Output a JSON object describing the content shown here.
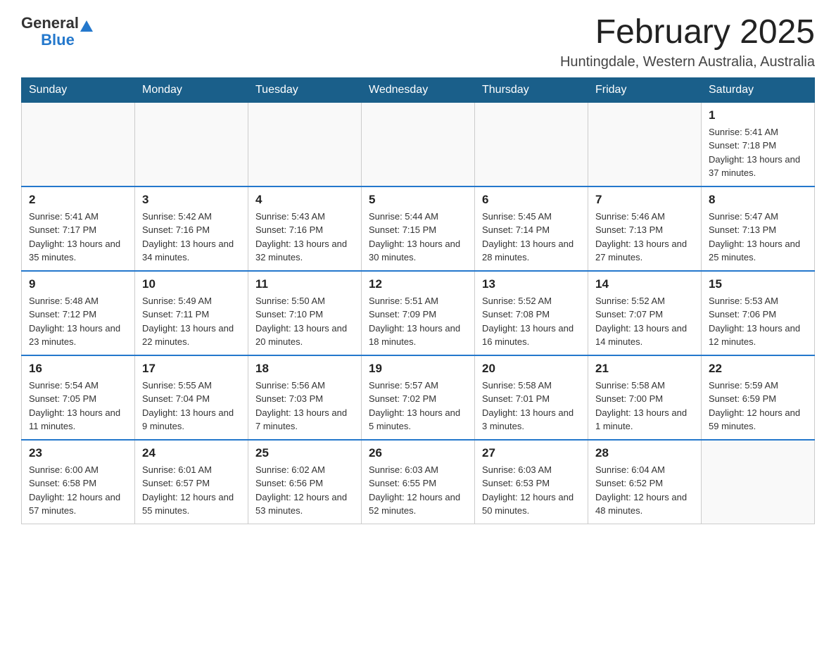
{
  "header": {
    "logo_general": "General",
    "logo_blue": "Blue",
    "month": "February 2025",
    "location": "Huntingdale, Western Australia, Australia"
  },
  "days_of_week": [
    "Sunday",
    "Monday",
    "Tuesday",
    "Wednesday",
    "Thursday",
    "Friday",
    "Saturday"
  ],
  "weeks": [
    [
      {
        "day": "",
        "info": ""
      },
      {
        "day": "",
        "info": ""
      },
      {
        "day": "",
        "info": ""
      },
      {
        "day": "",
        "info": ""
      },
      {
        "day": "",
        "info": ""
      },
      {
        "day": "",
        "info": ""
      },
      {
        "day": "1",
        "info": "Sunrise: 5:41 AM\nSunset: 7:18 PM\nDaylight: 13 hours and 37 minutes."
      }
    ],
    [
      {
        "day": "2",
        "info": "Sunrise: 5:41 AM\nSunset: 7:17 PM\nDaylight: 13 hours and 35 minutes."
      },
      {
        "day": "3",
        "info": "Sunrise: 5:42 AM\nSunset: 7:16 PM\nDaylight: 13 hours and 34 minutes."
      },
      {
        "day": "4",
        "info": "Sunrise: 5:43 AM\nSunset: 7:16 PM\nDaylight: 13 hours and 32 minutes."
      },
      {
        "day": "5",
        "info": "Sunrise: 5:44 AM\nSunset: 7:15 PM\nDaylight: 13 hours and 30 minutes."
      },
      {
        "day": "6",
        "info": "Sunrise: 5:45 AM\nSunset: 7:14 PM\nDaylight: 13 hours and 28 minutes."
      },
      {
        "day": "7",
        "info": "Sunrise: 5:46 AM\nSunset: 7:13 PM\nDaylight: 13 hours and 27 minutes."
      },
      {
        "day": "8",
        "info": "Sunrise: 5:47 AM\nSunset: 7:13 PM\nDaylight: 13 hours and 25 minutes."
      }
    ],
    [
      {
        "day": "9",
        "info": "Sunrise: 5:48 AM\nSunset: 7:12 PM\nDaylight: 13 hours and 23 minutes."
      },
      {
        "day": "10",
        "info": "Sunrise: 5:49 AM\nSunset: 7:11 PM\nDaylight: 13 hours and 22 minutes."
      },
      {
        "day": "11",
        "info": "Sunrise: 5:50 AM\nSunset: 7:10 PM\nDaylight: 13 hours and 20 minutes."
      },
      {
        "day": "12",
        "info": "Sunrise: 5:51 AM\nSunset: 7:09 PM\nDaylight: 13 hours and 18 minutes."
      },
      {
        "day": "13",
        "info": "Sunrise: 5:52 AM\nSunset: 7:08 PM\nDaylight: 13 hours and 16 minutes."
      },
      {
        "day": "14",
        "info": "Sunrise: 5:52 AM\nSunset: 7:07 PM\nDaylight: 13 hours and 14 minutes."
      },
      {
        "day": "15",
        "info": "Sunrise: 5:53 AM\nSunset: 7:06 PM\nDaylight: 13 hours and 12 minutes."
      }
    ],
    [
      {
        "day": "16",
        "info": "Sunrise: 5:54 AM\nSunset: 7:05 PM\nDaylight: 13 hours and 11 minutes."
      },
      {
        "day": "17",
        "info": "Sunrise: 5:55 AM\nSunset: 7:04 PM\nDaylight: 13 hours and 9 minutes."
      },
      {
        "day": "18",
        "info": "Sunrise: 5:56 AM\nSunset: 7:03 PM\nDaylight: 13 hours and 7 minutes."
      },
      {
        "day": "19",
        "info": "Sunrise: 5:57 AM\nSunset: 7:02 PM\nDaylight: 13 hours and 5 minutes."
      },
      {
        "day": "20",
        "info": "Sunrise: 5:58 AM\nSunset: 7:01 PM\nDaylight: 13 hours and 3 minutes."
      },
      {
        "day": "21",
        "info": "Sunrise: 5:58 AM\nSunset: 7:00 PM\nDaylight: 13 hours and 1 minute."
      },
      {
        "day": "22",
        "info": "Sunrise: 5:59 AM\nSunset: 6:59 PM\nDaylight: 12 hours and 59 minutes."
      }
    ],
    [
      {
        "day": "23",
        "info": "Sunrise: 6:00 AM\nSunset: 6:58 PM\nDaylight: 12 hours and 57 minutes."
      },
      {
        "day": "24",
        "info": "Sunrise: 6:01 AM\nSunset: 6:57 PM\nDaylight: 12 hours and 55 minutes."
      },
      {
        "day": "25",
        "info": "Sunrise: 6:02 AM\nSunset: 6:56 PM\nDaylight: 12 hours and 53 minutes."
      },
      {
        "day": "26",
        "info": "Sunrise: 6:03 AM\nSunset: 6:55 PM\nDaylight: 12 hours and 52 minutes."
      },
      {
        "day": "27",
        "info": "Sunrise: 6:03 AM\nSunset: 6:53 PM\nDaylight: 12 hours and 50 minutes."
      },
      {
        "day": "28",
        "info": "Sunrise: 6:04 AM\nSunset: 6:52 PM\nDaylight: 12 hours and 48 minutes."
      },
      {
        "day": "",
        "info": ""
      }
    ]
  ]
}
